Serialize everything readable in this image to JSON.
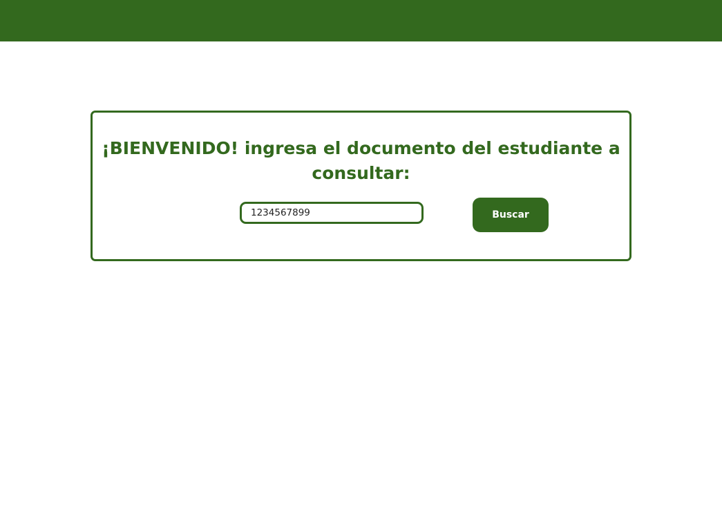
{
  "theme": {
    "primary_color": "#33691e",
    "background_color": "#ffffff"
  },
  "header": {},
  "search_card": {
    "title": "¡BIENVENIDO! ingresa el documento del estudiante a consultar:",
    "document_input": {
      "value": "1234567899",
      "placeholder": ""
    },
    "search_button_label": "Buscar"
  }
}
